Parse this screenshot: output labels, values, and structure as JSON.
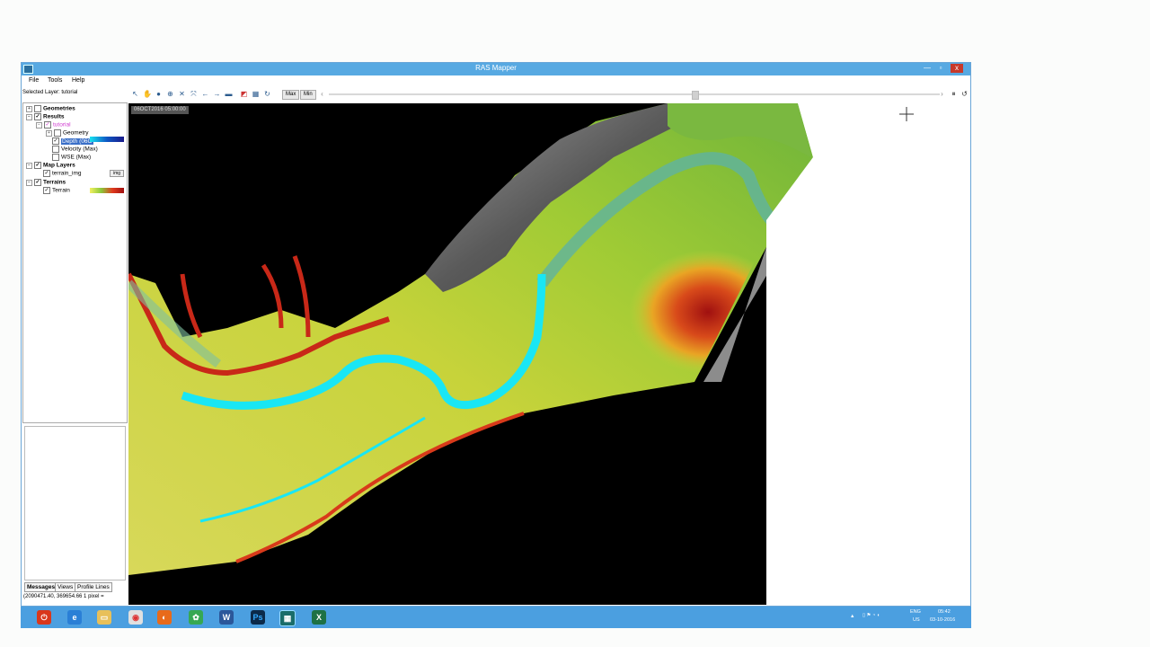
{
  "window": {
    "title": "RAS Mapper",
    "min": "—",
    "max": "▫",
    "close": "x"
  },
  "menu": [
    "File",
    "Tools",
    "Help"
  ],
  "selected_layer": "Selected Layer: tutorial",
  "toolbar": {
    "max_label": "Max",
    "min_label": "Min"
  },
  "tree": {
    "geometries": "Geometries",
    "results": "Results",
    "plan": "tutorial",
    "geometry": "Geometry",
    "depth": "Depth (06O",
    "velocity": "Velocity (Max)",
    "wse": "WSE (Max)",
    "map_layers": "Map Layers",
    "terrain_img": "terrain_img",
    "img_badge": "img",
    "terrains": "Terrains",
    "terrain": "Terrain"
  },
  "tabs": [
    "Messages",
    "Views",
    "Profile Lines"
  ],
  "coords": "(2090471.40, 369654.66  1 pixel =",
  "map": {
    "timestamp": "06OCT2016 05:00:00"
  },
  "colors": {
    "titlebar": "#57a9e2",
    "taskbar": "#4b9fe0",
    "depth": "#17e4f2",
    "terrain_low": "#c8d83a",
    "terrain_high": "#b01c10"
  },
  "taskbar": {
    "apps": [
      "power-icon",
      "ie-icon",
      "explorer-icon",
      "chrome-icon",
      "firefox-icon",
      "pinwheel-icon",
      "word-icon",
      "photoshop-icon",
      "hecras-icon",
      "excel-icon"
    ],
    "lang": "ENG",
    "region": "US",
    "time": "05:42",
    "date": "03-10-2016"
  }
}
